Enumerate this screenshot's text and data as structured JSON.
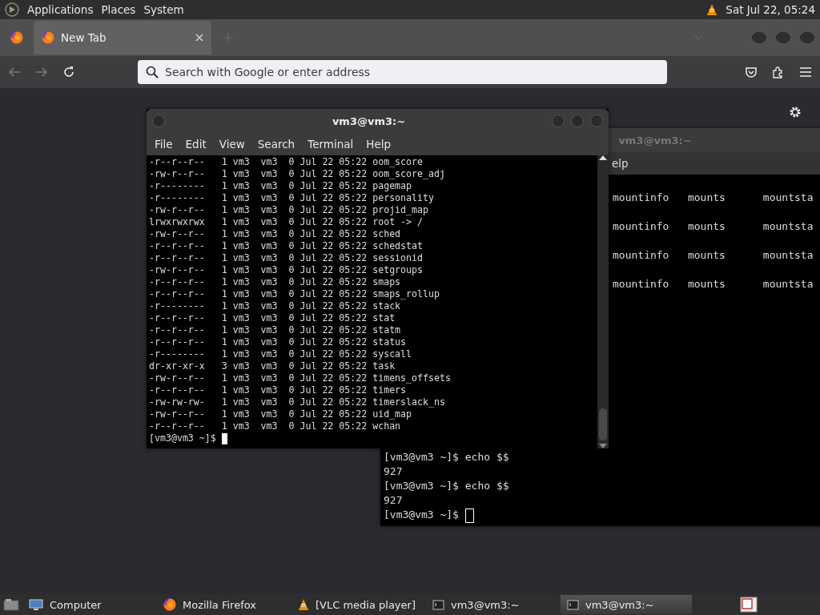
{
  "top_panel": {
    "menus": [
      "Applications",
      "Places",
      "System"
    ],
    "clock": "Sat Jul 22, 05:24"
  },
  "browser": {
    "tabs": [
      {
        "label": "New Tab",
        "selected": true
      }
    ],
    "address_bar": {
      "placeholder": "Search with Google or enter address"
    }
  },
  "terminals": [
    {
      "title": "vm3@vm3:~",
      "focused": false,
      "menus": [
        "elp"
      ],
      "column_rows": [
        "mountinfo   mounts      mountsta",
        "mountinfo   mounts      mountsta",
        "mountinfo   mounts      mountsta",
        "mountinfo   mounts      mountsta"
      ],
      "lines": [
        "[vm3@vm3 ~]$ echo $$",
        "927",
        "[vm3@vm3 ~]$ echo $$",
        "927",
        "[vm3@vm3 ~]$ "
      ]
    },
    {
      "title": "vm3@vm3:~",
      "focused": true,
      "menus": [
        "File",
        "Edit",
        "View",
        "Search",
        "Terminal",
        "Help"
      ],
      "lines": [
        "-r--r--r--   1 vm3  vm3  0 Jul 22 05:22 oom_score",
        "-rw-r--r--   1 vm3  vm3  0 Jul 22 05:22 oom_score_adj",
        "-r--------   1 vm3  vm3  0 Jul 22 05:22 pagemap",
        "-r--------   1 vm3  vm3  0 Jul 22 05:22 personality",
        "-rw-r--r--   1 vm3  vm3  0 Jul 22 05:22 projid_map",
        "lrwxrwxrwx   1 vm3  vm3  0 Jul 22 05:22 root -> /",
        "-rw-r--r--   1 vm3  vm3  0 Jul 22 05:22 sched",
        "-r--r--r--   1 vm3  vm3  0 Jul 22 05:22 schedstat",
        "-r--r--r--   1 vm3  vm3  0 Jul 22 05:22 sessionid",
        "-rw-r--r--   1 vm3  vm3  0 Jul 22 05:22 setgroups",
        "-r--r--r--   1 vm3  vm3  0 Jul 22 05:22 smaps",
        "-r--r--r--   1 vm3  vm3  0 Jul 22 05:22 smaps_rollup",
        "-r--------   1 vm3  vm3  0 Jul 22 05:22 stack",
        "-r--r--r--   1 vm3  vm3  0 Jul 22 05:22 stat",
        "-r--r--r--   1 vm3  vm3  0 Jul 22 05:22 statm",
        "-r--r--r--   1 vm3  vm3  0 Jul 22 05:22 status",
        "-r--------   1 vm3  vm3  0 Jul 22 05:22 syscall",
        "dr-xr-xr-x   3 vm3  vm3  0 Jul 22 05:22 task",
        "-rw-r--r--   1 vm3  vm3  0 Jul 22 05:22 timens_offsets",
        "-r--r--r--   1 vm3  vm3  0 Jul 22 05:22 timers",
        "-rw-rw-rw-   1 vm3  vm3  0 Jul 22 05:22 timerslack_ns",
        "-rw-r--r--   1 vm3  vm3  0 Jul 22 05:22 uid_map",
        "-r--r--r--   1 vm3  vm3  0 Jul 22 05:22 wchan",
        "[vm3@vm3 ~]$ "
      ]
    }
  ],
  "taskbar": {
    "items": [
      {
        "label": "Computer",
        "kind": "computer",
        "selected": false
      },
      {
        "label": "Mozilla Firefox",
        "kind": "firefox",
        "selected": false
      },
      {
        "label": "[VLC media player]",
        "kind": "vlc",
        "selected": false
      },
      {
        "label": "vm3@vm3:~",
        "kind": "terminal",
        "selected": false
      },
      {
        "label": "vm3@vm3:~",
        "kind": "terminal",
        "selected": true
      }
    ]
  }
}
